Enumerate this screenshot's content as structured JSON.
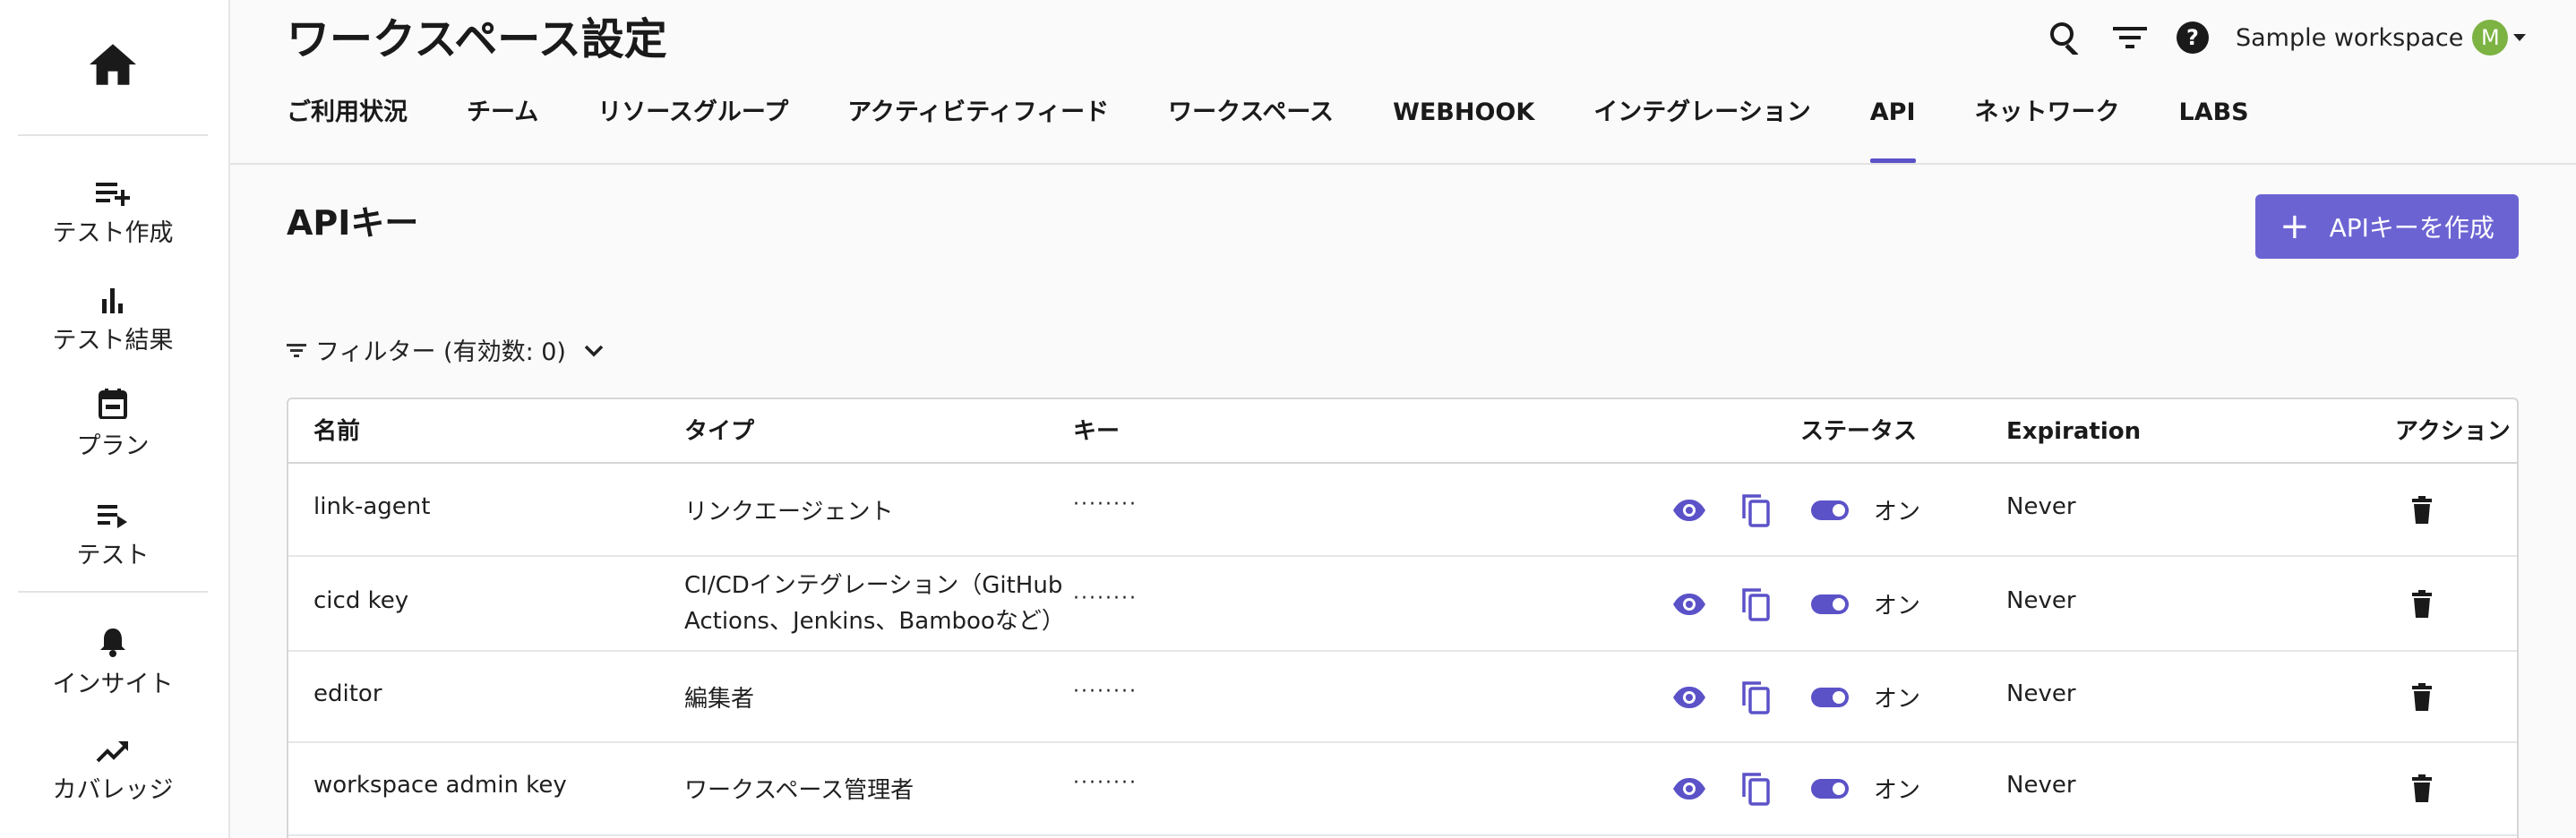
{
  "sidebar": {
    "items": [
      {
        "label": "テスト作成",
        "icon": "playlist-add-icon"
      },
      {
        "label": "テスト結果",
        "icon": "bar-chart-icon"
      },
      {
        "label": "プラン",
        "icon": "calendar-icon"
      },
      {
        "label": "テスト",
        "icon": "playlist-play-icon"
      },
      {
        "label": "インサイト",
        "icon": "bell-icon"
      },
      {
        "label": "カバレッジ",
        "icon": "trending-up-icon"
      }
    ]
  },
  "header": {
    "title": "ワークスペース設定",
    "workspace_name": "Sample workspace",
    "avatar_letter": "M",
    "avatar_color": "#7cb342"
  },
  "tabs": [
    {
      "label": "ご利用状況"
    },
    {
      "label": "チーム"
    },
    {
      "label": "リソースグループ"
    },
    {
      "label": "アクティビティフィード"
    },
    {
      "label": "ワークスペース"
    },
    {
      "label": "WEBHOOK"
    },
    {
      "label": "インテグレーション"
    },
    {
      "label": "API"
    },
    {
      "label": "ネットワーク"
    },
    {
      "label": "LABS"
    }
  ],
  "active_tab": "API",
  "content": {
    "title": "APIキー",
    "create_button": "APIキーを作成",
    "filter_label": "フィルター (有効数: 0)"
  },
  "table": {
    "headers": {
      "name": "名前",
      "type": "タイプ",
      "key": "キー",
      "status": "ステータス",
      "expiration": "Expiration",
      "action": "アクション"
    },
    "rows": [
      {
        "name": "link-agent",
        "type": "リンクエージェント",
        "key": "········",
        "status": "オン",
        "expiration": "Never"
      },
      {
        "name": "cicd key",
        "type": "CI/CDインテグレーション（GitHub Actions、Jenkins、Bambooなど）",
        "key": "········",
        "status": "オン",
        "expiration": "Never"
      },
      {
        "name": "editor",
        "type": "編集者",
        "key": "········",
        "status": "オン",
        "expiration": "Never"
      },
      {
        "name": "workspace admin key",
        "type": "ワークスペース管理者",
        "key": "········",
        "status": "オン",
        "expiration": "Never"
      }
    ]
  },
  "colors": {
    "accent": "#6c63d3",
    "accent_dark": "#5b52c8"
  }
}
